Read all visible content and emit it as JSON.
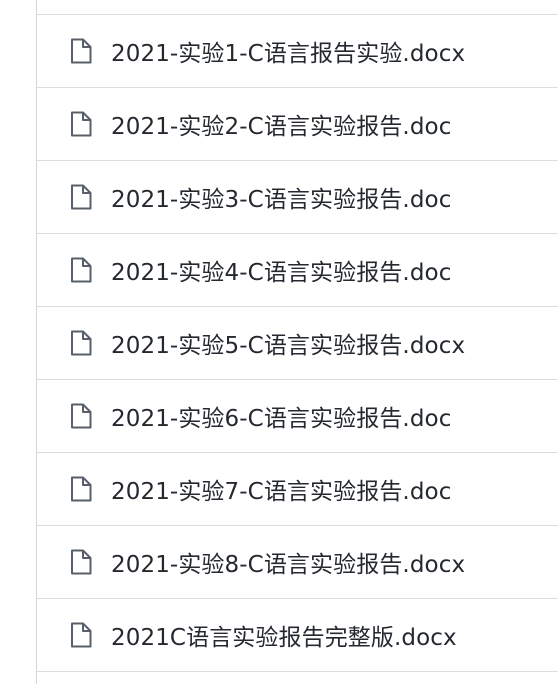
{
  "icon_color": "#57606a",
  "text_color": "#24292f",
  "files": [
    {
      "name": "2021-实验1-C语言报告实验.docx",
      "icon": "file-icon"
    },
    {
      "name": "2021-实验2-C语言实验报告.doc",
      "icon": "file-icon"
    },
    {
      "name": "2021-实验3-C语言实验报告.doc",
      "icon": "file-icon"
    },
    {
      "name": "2021-实验4-C语言实验报告.doc",
      "icon": "file-icon"
    },
    {
      "name": "2021-实验5-C语言实验报告.docx",
      "icon": "file-icon"
    },
    {
      "name": "2021-实验6-C语言实验报告.doc",
      "icon": "file-icon"
    },
    {
      "name": "2021-实验7-C语言实验报告.doc",
      "icon": "file-icon"
    },
    {
      "name": "2021-实验8-C语言实验报告.docx",
      "icon": "file-icon"
    },
    {
      "name": "2021C语言实验报告完整版.docx",
      "icon": "file-icon"
    }
  ]
}
